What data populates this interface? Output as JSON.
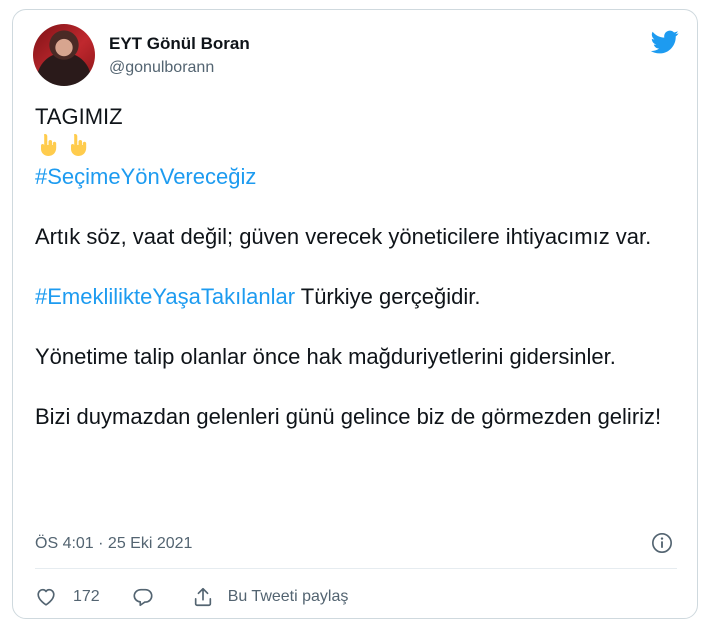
{
  "tweet": {
    "author": {
      "display_name": "EYT Gönül Boran",
      "handle": "@gonulborann"
    },
    "text": {
      "line1": "TAGIMIZ",
      "emoji": [
        "👇",
        "👇"
      ],
      "hashtag1": "#SeçimeYönVereceğiz",
      "paragraph2": "Artık söz, vaat değil; güven verecek yöneticilere ihtiyacımız var.",
      "hashtag2": "#EmeklilikteYaşaTakılanlar",
      "paragraph3_suffix": " Türkiye gerçeğidir.",
      "paragraph4": "Yönetime talip olanlar önce hak mağduriyetlerini gidersinler.",
      "paragraph5": "Bizi duymazdan gelenleri günü gelince biz de görmezden geliriz!"
    },
    "timestamp": "ÖS 4:01 · 25 Eki 2021",
    "actions": {
      "like_count": "172",
      "share_label": "Bu Tweeti paylaş"
    }
  },
  "colors": {
    "hashtag": "#1d9bf0",
    "twitter_blue": "#1d9bf0",
    "secondary_text": "#536471",
    "border": "#cfd9de"
  },
  "icons": [
    "twitter-bird-icon",
    "info-icon",
    "heart-icon",
    "reply-icon",
    "share-icon",
    "pointing-down-emoji"
  ]
}
